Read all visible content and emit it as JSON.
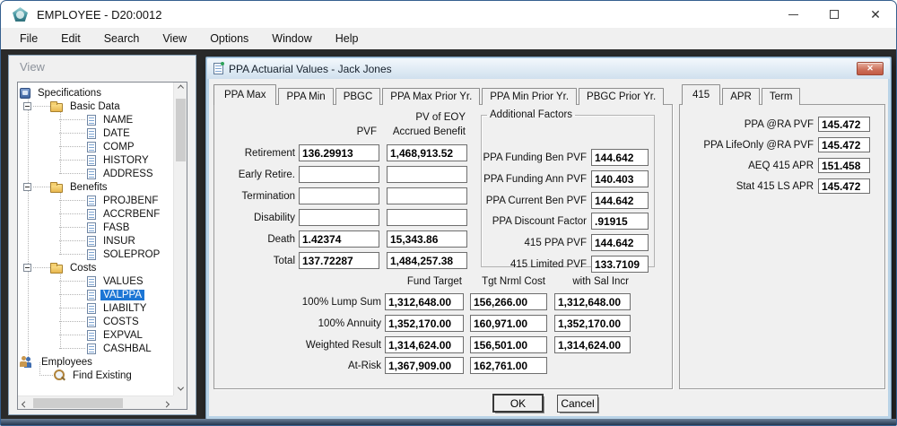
{
  "window": {
    "title": "EMPLOYEE - D20:0012"
  },
  "menu": {
    "items": [
      "File",
      "Edit",
      "Search",
      "View",
      "Options",
      "Window",
      "Help"
    ]
  },
  "view_panel": {
    "title": "View",
    "tree": [
      {
        "label": "Specifications",
        "icon": "specifications",
        "depth": 0
      },
      {
        "label": "Basic Data",
        "icon": "folder",
        "depth": 1,
        "expander": "minus"
      },
      {
        "label": "NAME",
        "icon": "document",
        "depth": 2
      },
      {
        "label": "DATE",
        "icon": "document",
        "depth": 2
      },
      {
        "label": "COMP",
        "icon": "document",
        "depth": 2
      },
      {
        "label": "HISTORY",
        "icon": "document",
        "depth": 2
      },
      {
        "label": "ADDRESS",
        "icon": "document",
        "depth": 2
      },
      {
        "label": "Benefits",
        "icon": "folder",
        "depth": 1,
        "expander": "minus"
      },
      {
        "label": "PROJBENF",
        "icon": "document",
        "depth": 2
      },
      {
        "label": "ACCRBENF",
        "icon": "document",
        "depth": 2
      },
      {
        "label": "FASB",
        "icon": "document",
        "depth": 2
      },
      {
        "label": "INSUR",
        "icon": "document",
        "depth": 2
      },
      {
        "label": "SOLEPROP",
        "icon": "document",
        "depth": 2
      },
      {
        "label": "Costs",
        "icon": "folder",
        "depth": 1,
        "expander": "minus"
      },
      {
        "label": "VALUES",
        "icon": "document",
        "depth": 2
      },
      {
        "label": "VALPPA",
        "icon": "document",
        "depth": 2,
        "selected": true
      },
      {
        "label": "LIABILTY",
        "icon": "document",
        "depth": 2
      },
      {
        "label": "COSTS",
        "icon": "document",
        "depth": 2
      },
      {
        "label": "EXPVAL",
        "icon": "document",
        "depth": 2
      },
      {
        "label": "CASHBAL",
        "icon": "document",
        "depth": 2
      },
      {
        "label": "Employees",
        "icon": "employees",
        "depth": 0
      },
      {
        "label": "Find Existing",
        "icon": "search",
        "depth": 1
      }
    ]
  },
  "dialog": {
    "title": "PPA Actuarial Values - Jack Jones",
    "left_tabs": [
      {
        "label": "PPA Max",
        "active": true
      },
      {
        "label": "PPA Min"
      },
      {
        "label": "PBGC"
      },
      {
        "label": "PPA Max Prior Yr."
      },
      {
        "label": "PPA Min Prior Yr."
      },
      {
        "label": "PBGC Prior Yr."
      }
    ],
    "right_tabs": [
      {
        "label": "415",
        "active": true
      },
      {
        "label": "APR"
      },
      {
        "label": "Term"
      }
    ],
    "pvf_table": {
      "col1_header": "PVF",
      "col2_header_top": "PV of EOY",
      "col2_header_bottom": "Accrued Benefit",
      "rows": [
        {
          "label": "Retirement",
          "pvf": "136.29913",
          "accrued": "1,468,913.52"
        },
        {
          "label": "Early Retire.",
          "pvf": "",
          "accrued": ""
        },
        {
          "label": "Termination",
          "pvf": "",
          "accrued": ""
        },
        {
          "label": "Disability",
          "pvf": "",
          "accrued": ""
        },
        {
          "label": "Death",
          "pvf": "1.42374",
          "accrued": "15,343.86"
        },
        {
          "label": "Total",
          "pvf": "137.72287",
          "accrued": "1,484,257.38"
        }
      ]
    },
    "additional_factors": {
      "title": "Additional Factors",
      "rows": [
        {
          "label": "PPA Funding Ben PVF",
          "value": "144.642"
        },
        {
          "label": "PPA Funding Ann PVF",
          "value": "140.403"
        },
        {
          "label": "PPA Current Ben PVF",
          "value": "144.642"
        },
        {
          "label": "PPA Discount Factor",
          "value": ".91915"
        },
        {
          "label": "415 PPA PVF",
          "value": "144.642"
        },
        {
          "label": "415 Limited PVF",
          "value": "133.7109"
        }
      ]
    },
    "cost_table": {
      "headers": [
        "Fund Target",
        "Tgt Nrml Cost",
        "with Sal Incr"
      ],
      "rows": [
        {
          "label": "100% Lump Sum",
          "values": [
            "1,312,648.00",
            "156,266.00",
            "1,312,648.00"
          ]
        },
        {
          "label": "100% Annuity",
          "values": [
            "1,352,170.00",
            "160,971.00",
            "1,352,170.00"
          ]
        },
        {
          "label": "Weighted Result",
          "values": [
            "1,314,624.00",
            "156,501.00",
            "1,314,624.00"
          ]
        },
        {
          "label": "At-Risk",
          "values": [
            "1,367,909.00",
            "162,761.00"
          ]
        }
      ]
    },
    "right_panel": {
      "rows": [
        {
          "label": "PPA @RA PVF",
          "value": "145.472"
        },
        {
          "label": "PPA LifeOnly @RA PVF",
          "value": "145.472"
        },
        {
          "label": "AEQ 415 APR",
          "value": "151.458"
        },
        {
          "label": "Stat 415 LS APR",
          "value": "145.472"
        }
      ]
    },
    "buttons": {
      "ok": "OK",
      "cancel": "Cancel"
    }
  },
  "colors": {
    "selection": "#1c76d5",
    "dialog_border": "#b9d3e7",
    "close_button": "#c25b44",
    "mdi_background": "#2a2a2a"
  }
}
